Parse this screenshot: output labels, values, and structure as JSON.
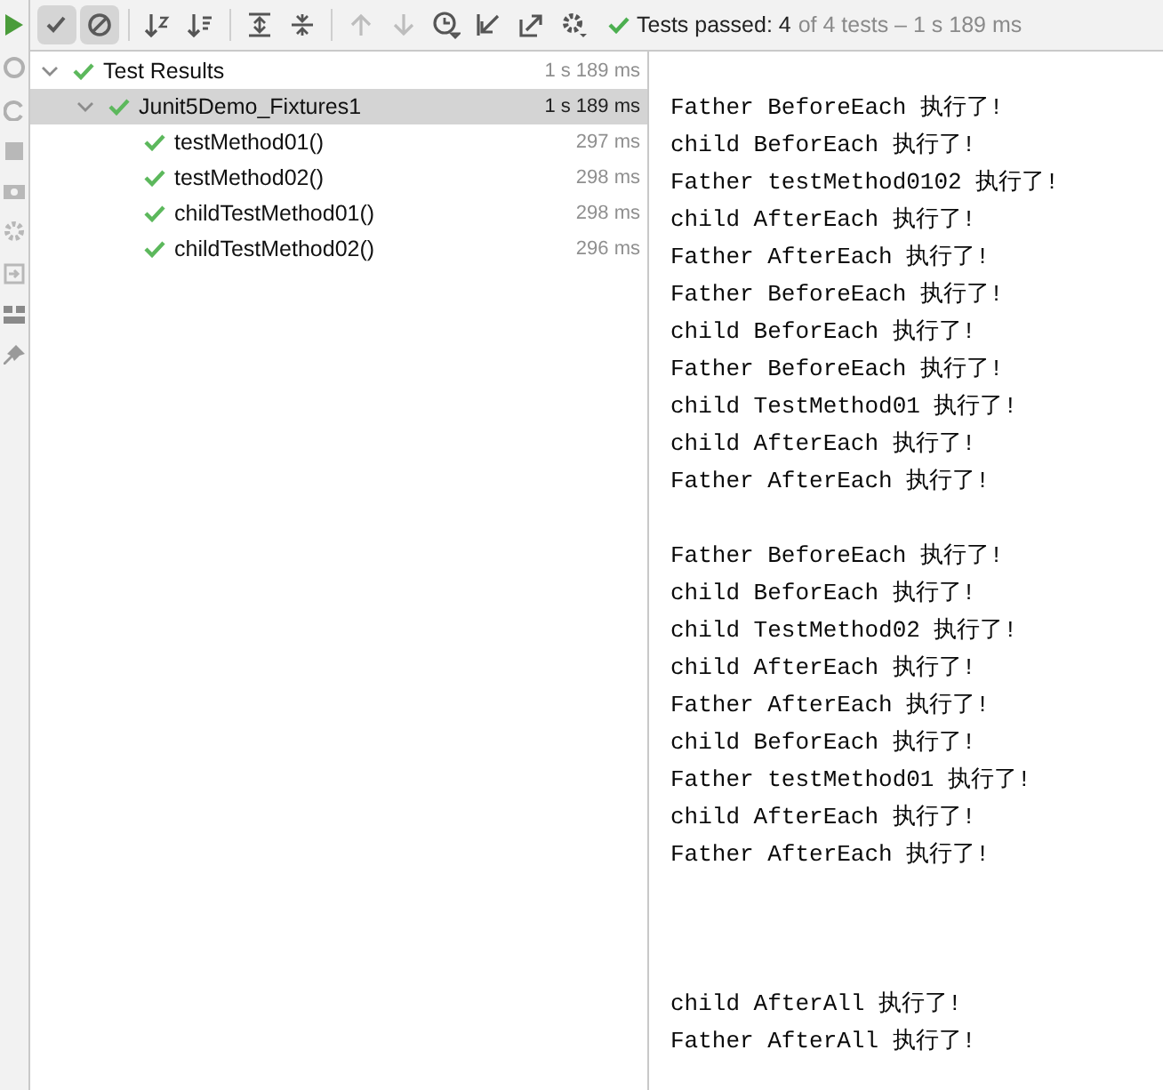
{
  "toolbar": {
    "toggles": [
      {
        "kind": "passed",
        "selected": true
      },
      {
        "kind": "ignored",
        "selected": true
      }
    ],
    "status": {
      "label": "Tests passed: 4",
      "detail": "of 4 tests – 1 s 189 ms"
    }
  },
  "tree": {
    "label": "Test Results",
    "duration": "1 s 189 ms",
    "expanded": true,
    "selected": false,
    "children": [
      {
        "label": "Junit5Demo_Fixtures1",
        "duration": "1 s 189 ms",
        "expanded": true,
        "selected": true,
        "children": [
          {
            "label": "testMethod01()",
            "duration": "297 ms",
            "selected": false
          },
          {
            "label": "testMethod02()",
            "duration": "298 ms",
            "selected": false
          },
          {
            "label": "childTestMethod01()",
            "duration": "298 ms",
            "selected": false
          },
          {
            "label": "childTestMethod02()",
            "duration": "296 ms",
            "selected": false
          }
        ]
      }
    ]
  },
  "console": [
    {
      "kind": "blank"
    },
    {
      "kind": "text",
      "text": "Father BeforeEach 执行了!"
    },
    {
      "kind": "text",
      "text": "child BeforEach 执行了!"
    },
    {
      "kind": "text",
      "text": "Father testMethod0102 执行了!"
    },
    {
      "kind": "text",
      "text": "child AfterEach 执行了!"
    },
    {
      "kind": "text",
      "text": "Father AfterEach 执行了!"
    },
    {
      "kind": "text",
      "text": "Father BeforeEach 执行了!"
    },
    {
      "kind": "text",
      "text": "child BeforEach 执行了!"
    },
    {
      "kind": "text",
      "text": "Father BeforeEach 执行了!"
    },
    {
      "kind": "text",
      "text": "child TestMethod01 执行了!"
    },
    {
      "kind": "text",
      "text": "child AfterEach 执行了!"
    },
    {
      "kind": "text",
      "text": "Father AfterEach 执行了!"
    },
    {
      "kind": "blank"
    },
    {
      "kind": "text",
      "text": "Father BeforeEach 执行了!"
    },
    {
      "kind": "text",
      "text": "child BeforEach 执行了!"
    },
    {
      "kind": "text",
      "text": "child TestMethod02 执行了!"
    },
    {
      "kind": "text",
      "text": "child AfterEach 执行了!"
    },
    {
      "kind": "text",
      "text": "Father AfterEach 执行了!"
    },
    {
      "kind": "text",
      "text": "child BeforEach 执行了!"
    },
    {
      "kind": "text",
      "text": "Father testMethod01 执行了!"
    },
    {
      "kind": "text",
      "text": "child AfterEach 执行了!"
    },
    {
      "kind": "text",
      "text": "Father AfterEach 执行了!"
    },
    {
      "kind": "blank"
    },
    {
      "kind": "blank"
    },
    {
      "kind": "blank"
    },
    {
      "kind": "text",
      "text": "child AfterAll 执行了!"
    },
    {
      "kind": "text",
      "text": "Father AfterAll 执行了!"
    }
  ]
}
